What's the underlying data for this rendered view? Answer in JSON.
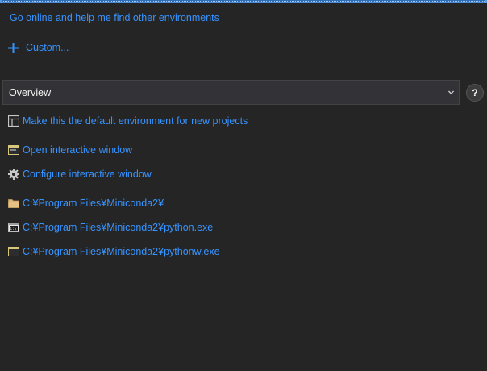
{
  "links": {
    "go_online": "Go online and help me find other environments",
    "custom": "Custom..."
  },
  "view_select": {
    "selected": "Overview"
  },
  "help_label": "?",
  "actions": [
    {
      "icon": "layout-icon",
      "label": "Make this the default environment for new projects"
    },
    {
      "icon": "interactive-window-icon",
      "label": "Open interactive window"
    },
    {
      "icon": "gear-icon",
      "label": "Configure interactive window"
    },
    {
      "icon": "folder-icon",
      "label": "C:¥Program Files¥Miniconda2¥"
    },
    {
      "icon": "console-icon",
      "label": "C:¥Program Files¥Miniconda2¥python.exe"
    },
    {
      "icon": "window-icon",
      "label": "C:¥Program Files¥Miniconda2¥pythonw.exe"
    }
  ],
  "colors": {
    "background": "#252526",
    "link": "#3794ff",
    "accent": "#2f6fb8"
  }
}
